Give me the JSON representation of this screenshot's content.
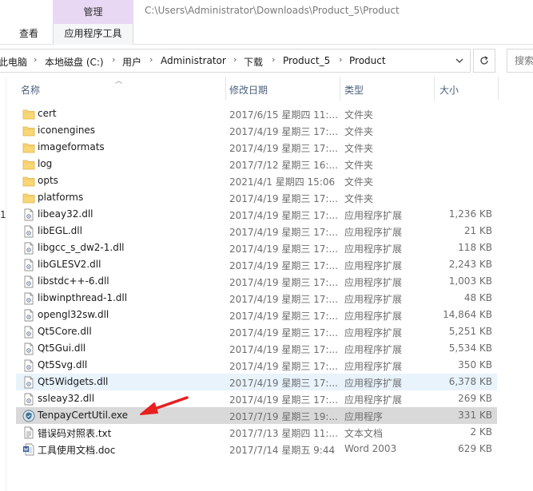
{
  "ribbon": {
    "manage_tab": "管理",
    "tools_tab": "应用程序工具",
    "view_tab": "查看",
    "title_path": "C:\\Users\\Administrator\\Downloads\\Product_5\\Product"
  },
  "address": {
    "crumbs": [
      "此电脑",
      "本地磁盘 (C:)",
      "用户",
      "Administrator",
      "下载",
      "Product_5",
      "Product"
    ],
    "search_placeholder": "搜索"
  },
  "nav_pane": {
    "partial_label": "1"
  },
  "columns": {
    "name": "名称",
    "date": "修改日期",
    "type": "类型",
    "size": "大小"
  },
  "files": [
    {
      "name": "cert",
      "date": "2017/6/15 星期四 11:...",
      "type": "文件夹",
      "size": "",
      "icon": "folder-icon"
    },
    {
      "name": "iconengines",
      "date": "2017/4/19 星期三 17:...",
      "type": "文件夹",
      "size": "",
      "icon": "folder-icon"
    },
    {
      "name": "imageformats",
      "date": "2017/4/19 星期三 17:...",
      "type": "文件夹",
      "size": "",
      "icon": "folder-icon"
    },
    {
      "name": "log",
      "date": "2017/7/12 星期三 16:...",
      "type": "文件夹",
      "size": "",
      "icon": "folder-icon"
    },
    {
      "name": "opts",
      "date": "2021/4/1 星期四 15:06",
      "type": "文件夹",
      "size": "",
      "icon": "folder-icon"
    },
    {
      "name": "platforms",
      "date": "2017/4/19 星期三 17:...",
      "type": "文件夹",
      "size": "",
      "icon": "folder-icon"
    },
    {
      "name": "libeay32.dll",
      "date": "2017/4/19 星期三 17:...",
      "type": "应用程序扩展",
      "size": "1,236 KB",
      "icon": "dll-icon"
    },
    {
      "name": "libEGL.dll",
      "date": "2017/4/19 星期三 17:...",
      "type": "应用程序扩展",
      "size": "21 KB",
      "icon": "dll-icon"
    },
    {
      "name": "libgcc_s_dw2-1.dll",
      "date": "2017/4/19 星期三 17:...",
      "type": "应用程序扩展",
      "size": "118 KB",
      "icon": "dll-icon"
    },
    {
      "name": "libGLESV2.dll",
      "date": "2017/4/19 星期三 17:...",
      "type": "应用程序扩展",
      "size": "2,243 KB",
      "icon": "dll-icon"
    },
    {
      "name": "libstdc++-6.dll",
      "date": "2017/4/19 星期三 17:...",
      "type": "应用程序扩展",
      "size": "1,003 KB",
      "icon": "dll-icon"
    },
    {
      "name": "libwinpthread-1.dll",
      "date": "2017/4/19 星期三 17:...",
      "type": "应用程序扩展",
      "size": "48 KB",
      "icon": "dll-icon"
    },
    {
      "name": "opengl32sw.dll",
      "date": "2017/4/19 星期三 17:...",
      "type": "应用程序扩展",
      "size": "14,864 KB",
      "icon": "dll-icon"
    },
    {
      "name": "Qt5Core.dll",
      "date": "2017/4/19 星期三 17:...",
      "type": "应用程序扩展",
      "size": "5,251 KB",
      "icon": "dll-icon"
    },
    {
      "name": "Qt5Gui.dll",
      "date": "2017/4/19 星期三 17:...",
      "type": "应用程序扩展",
      "size": "5,534 KB",
      "icon": "dll-icon"
    },
    {
      "name": "Qt5Svg.dll",
      "date": "2017/4/19 星期三 17:...",
      "type": "应用程序扩展",
      "size": "350 KB",
      "icon": "dll-icon"
    },
    {
      "name": "Qt5Widgets.dll",
      "date": "2017/4/19 星期三 17:...",
      "type": "应用程序扩展",
      "size": "6,378 KB",
      "icon": "dll-icon",
      "state": "hover"
    },
    {
      "name": "ssleay32.dll",
      "date": "2017/4/19 星期三 17:...",
      "type": "应用程序扩展",
      "size": "269 KB",
      "icon": "dll-icon"
    },
    {
      "name": "TenpayCertUtil.exe",
      "date": "2017/7/19 星期三 19:...",
      "type": "应用程序",
      "size": "331 KB",
      "icon": "shield-app-icon",
      "state": "selected"
    },
    {
      "name": "错误码对照表.txt",
      "date": "2017/7/13 星期四 11:...",
      "type": "文本文档",
      "size": "2 KB",
      "icon": "text-file-icon"
    },
    {
      "name": "工具使用文档.doc",
      "date": "2017/7/14 星期五 9:44",
      "type": "Word 2003",
      "size": "629 KB",
      "icon": "word-doc-icon"
    }
  ],
  "colors": {
    "manage_tab_bg": "#e9d8f3",
    "header_text": "#4c607a",
    "hover_row": "#e8f3fc",
    "selected_row": "#d9d9d9",
    "annotation_arrow": "#e8201f"
  }
}
